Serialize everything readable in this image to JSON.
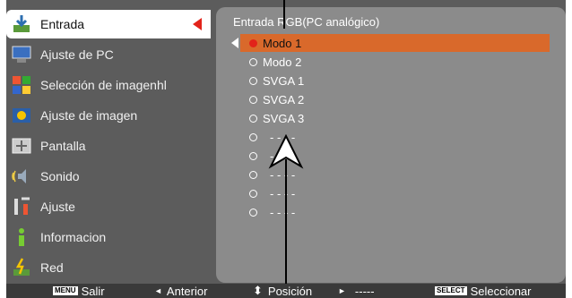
{
  "menu": {
    "items": [
      {
        "label": "Entrada",
        "icon": "input-icon",
        "selected": true
      },
      {
        "label": "Ajuste de PC",
        "icon": "pc-adjust-icon"
      },
      {
        "label": "Selección de imagenhl",
        "icon": "image-select-icon"
      },
      {
        "label": "Ajuste de imagen",
        "icon": "image-adjust-icon"
      },
      {
        "label": "Pantalla",
        "icon": "screen-icon"
      },
      {
        "label": "Sonido",
        "icon": "sound-icon"
      },
      {
        "label": "Ajuste",
        "icon": "settings-icon"
      },
      {
        "label": "Informacion",
        "icon": "info-icon"
      },
      {
        "label": "Red",
        "icon": "network-icon"
      }
    ]
  },
  "panel": {
    "title": "Entrada RGB(PC analógico)",
    "options": [
      {
        "label": "Modo 1",
        "active": true
      },
      {
        "label": "Modo 2"
      },
      {
        "label": "SVGA 1"
      },
      {
        "label": "SVGA 2"
      },
      {
        "label": "SVGA 3"
      },
      {
        "label": "- - - -"
      },
      {
        "label": "- - - -"
      },
      {
        "label": "- - - -"
      },
      {
        "label": "- - - -"
      },
      {
        "label": "- - - -"
      }
    ]
  },
  "bottombar": {
    "menu_key": "MENU",
    "exit": "Salir",
    "back_arrow": "◄",
    "back": "Anterior",
    "pos_arrow": "⬍",
    "position": "Posición",
    "next_arrow": "►",
    "next": "-----",
    "select_key": "SELECT",
    "select": "Seleccionar"
  },
  "colors": {
    "highlight": "#d9692b",
    "accent": "#e2231a",
    "panel": "#8b8b8b"
  }
}
